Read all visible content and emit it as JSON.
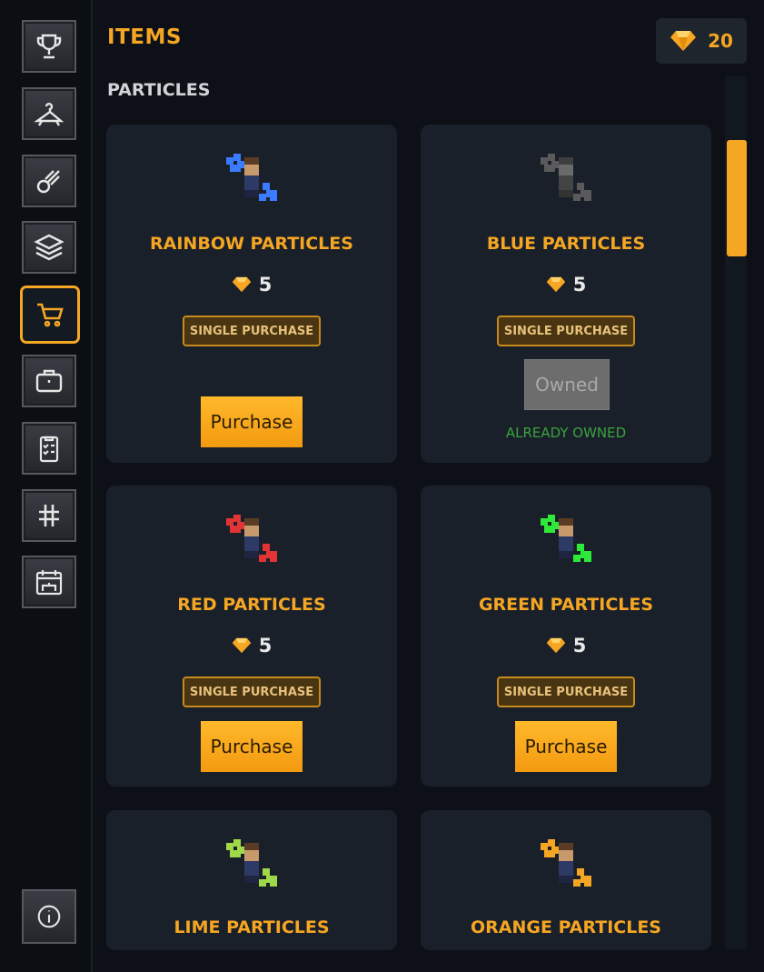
{
  "header": {
    "title": "ITEMS",
    "gem_icon": "gem-icon",
    "gem_balance": "20"
  },
  "section": {
    "title": "PARTICLES"
  },
  "sidebar": {
    "items": [
      {
        "icon": "trophy-icon"
      },
      {
        "icon": "hanger-icon"
      },
      {
        "icon": "comet-icon"
      },
      {
        "icon": "layers-icon"
      },
      {
        "icon": "cart-icon",
        "active": true
      },
      {
        "icon": "briefcase-icon"
      },
      {
        "icon": "clipboard-checklist-icon"
      },
      {
        "icon": "hashtag-icon"
      },
      {
        "icon": "calendar-cake-icon"
      }
    ],
    "info_icon": "info-icon"
  },
  "colors": {
    "accent": "#f5a623",
    "background": "#0d1117",
    "card": "#1a2029",
    "owned_text": "#3aa23f"
  },
  "cards": [
    {
      "name": "RAINBOW PARTICLES",
      "price": "5",
      "badge": "SINGLE PURCHASE",
      "button": "Purchase",
      "particle_color": "#3b7bff"
    },
    {
      "name": "BLUE PARTICLES",
      "price": "5",
      "badge": "SINGLE PURCHASE",
      "button": "Owned",
      "status": "ALREADY OWNED",
      "particle_color": "#5a5a5a"
    },
    {
      "name": "RED PARTICLES",
      "price": "5",
      "badge": "SINGLE PURCHASE",
      "button": "Purchase",
      "particle_color": "#e23434"
    },
    {
      "name": "GREEN PARTICLES",
      "price": "5",
      "badge": "SINGLE PURCHASE",
      "button": "Purchase",
      "particle_color": "#2ee83a"
    },
    {
      "name": "LIME PARTICLES",
      "particle_color": "#9fd94a"
    },
    {
      "name": "ORANGE PARTICLES",
      "particle_color": "#f5a623"
    }
  ]
}
